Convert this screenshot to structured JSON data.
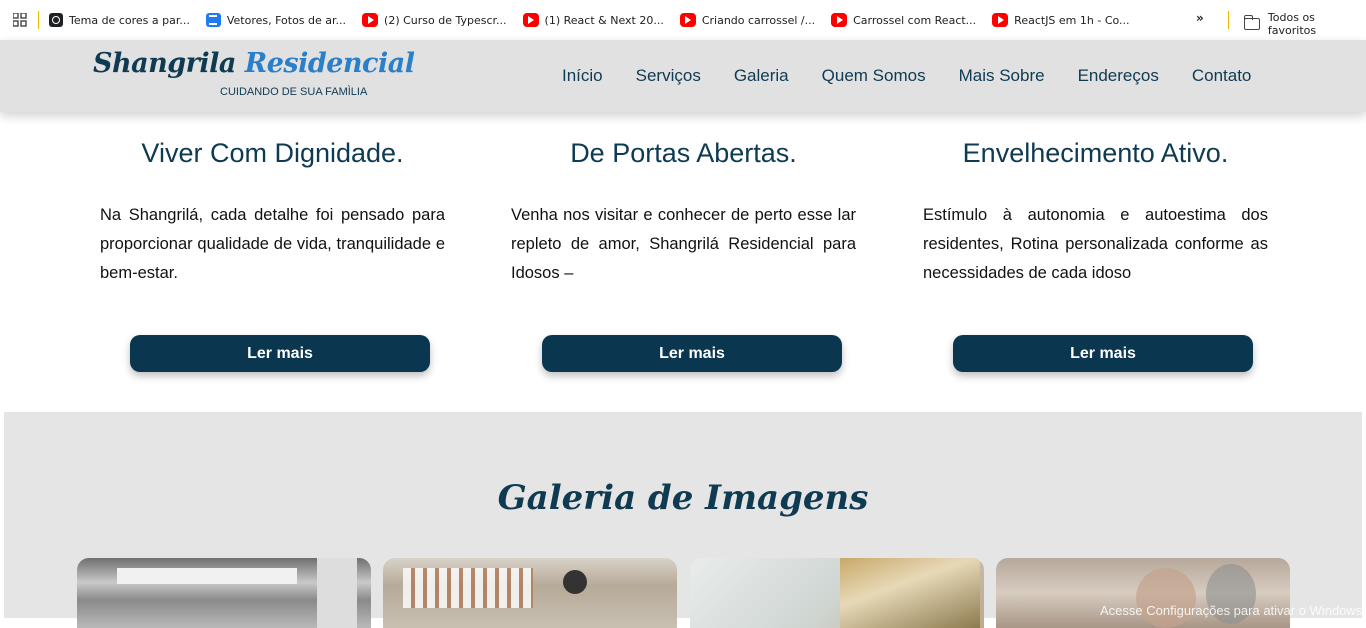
{
  "bookmarks": {
    "items": [
      {
        "label": "Tema de cores a par...",
        "icon": "theme-icon"
      },
      {
        "label": "Vetores, Fotos de ar...",
        "icon": "vectors-icon"
      },
      {
        "label": "(2) Curso de Typescr...",
        "icon": "youtube-icon"
      },
      {
        "label": "(1) React & Next 20...",
        "icon": "youtube-icon"
      },
      {
        "label": "Criando carrossel /...",
        "icon": "youtube-icon"
      },
      {
        "label": "Carrossel com React...",
        "icon": "youtube-icon"
      },
      {
        "label": "ReactJS em 1h - Co...",
        "icon": "youtube-icon"
      }
    ],
    "more": "»",
    "all": "Todos os favoritos"
  },
  "header": {
    "logo_part1": "Shangrila",
    "logo_part2": "Residencial",
    "tagline": "CUIDANDO DE SUA FAMÌLIA",
    "nav": [
      "Início",
      "Serviços",
      "Galeria",
      "Quem Somos",
      "Mais Sobre",
      "Endereços",
      "Contato"
    ]
  },
  "features": [
    {
      "title": "Viver Com Dignidade.",
      "text": "Na Shangrilá, cada detalhe foi pensado para proporcionar qualidade de vida, tranquilidade e bem-estar.",
      "button": "Ler mais"
    },
    {
      "title": "De Portas Abertas.",
      "text": "Venha nos visitar e conhecer de perto esse lar repleto de amor, Shangrilá Residencial para Idosos –",
      "button": "Ler mais"
    },
    {
      "title": "Envelhecimento Ativo.",
      "text": "Estímulo à autonomia e autoestima dos residentes, Rotina personalizada conforme as necessidades de cada idoso",
      "button": "Ler mais"
    }
  ],
  "gallery": {
    "title": "Galeria de Imagens"
  },
  "watermark": "Acesse Configurações para ativar o Windows.",
  "colors": {
    "primary": "#0e3a52",
    "button": "#0b3650",
    "header_bg": "#e1e1e1",
    "gallery_bg": "#e5e5e5",
    "logo_accent": "#2a7fc9"
  }
}
